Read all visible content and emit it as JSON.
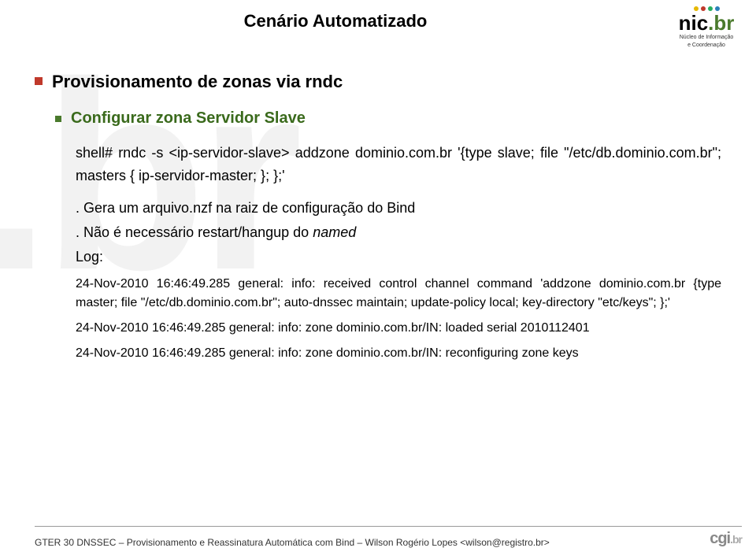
{
  "header": {
    "title": "Cenário Automatizado",
    "logo_nic_main": "nic",
    "logo_nic_suffix": ".br",
    "logo_nic_sub1": "Núcleo de Informação",
    "logo_nic_sub2": "e Coordenação"
  },
  "content": {
    "bullet1": "Provisionamento de zonas via rndc",
    "bullet2": "Configurar zona Servidor Slave",
    "shell_cmd": "shell# rndc -s <ip-servidor-slave> addzone dominio.com.br '{type slave; file \"/etc/db.dominio.com.br\"; masters { ip-servidor-master; }; };'",
    "note1_prefix": ". Gera um arquivo.nzf na raiz de configuração do Bind",
    "note2_prefix": ". Não é necessário restart/hangup do ",
    "note2_em": "named",
    "log_label": "Log:",
    "log1": "24-Nov-2010 16:46:49.285 general: info: received control channel command 'addzone dominio.com.br {type master; file \"/etc/db.dominio.com.br\"; auto-dnssec maintain; update-policy local;  key-directory \"etc/keys\"; };'",
    "log2": "24-Nov-2010 16:46:49.285 general: info: zone dominio.com.br/IN: loaded serial 2010112401",
    "log3": "24-Nov-2010 16:46:49.285 general: info: zone dominio.com.br/IN: reconfiguring zone keys"
  },
  "footer": {
    "text": "GTER 30  DNSSEC – Provisionamento e Reassinatura Automática com Bind – Wilson Rogério Lopes <wilson@registro.br>",
    "logo_cgi_main": "cgi",
    "logo_cgi_suffix": ".br"
  },
  "watermark": ".br"
}
